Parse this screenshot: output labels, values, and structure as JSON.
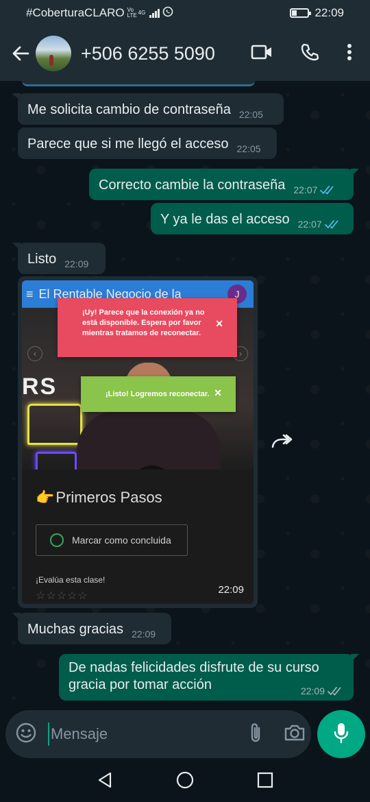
{
  "status_bar": {
    "carrier": "#CoberturaCLARO",
    "volte": "Vo LTE",
    "network": "4G",
    "time": "22:09"
  },
  "header": {
    "contact": "+506 6255 5090",
    "icons": [
      "back-arrow-icon",
      "video-call-icon",
      "phone-icon",
      "more-vert-icon"
    ]
  },
  "messages": [
    {
      "dir": "in",
      "text": "Me solicita cambio de contraseña",
      "time": "22:05"
    },
    {
      "dir": "in",
      "text": "Parece que si me llegó el acceso",
      "time": "22:05"
    },
    {
      "dir": "out",
      "text": "Correcto cambie la contraseña",
      "time": "22:07",
      "status": "read"
    },
    {
      "dir": "out",
      "text": "Y ya le das el acceso",
      "time": "22:07",
      "status": "read"
    },
    {
      "dir": "in",
      "text": "Listo",
      "time": "22:09"
    },
    {
      "dir": "in",
      "text": "Muchas gracias",
      "time": "22:09"
    },
    {
      "dir": "out",
      "text": "De nadas felicidades disfrute de su curso gracia por tomar acción",
      "time": "22:09",
      "status": "delivered"
    }
  ],
  "media_message": {
    "time": "22:09",
    "screenshot": {
      "bar_title": "El Rentable Negocio de la",
      "avatar_letter": "J",
      "brand_fragment": "RS",
      "alert_red": "¡Uy! Parece que la conexión ya no está disponible. Espera por favor mientras tratamos de reconectar.",
      "alert_green": "¡Listo! Logremos reconectar.",
      "close_glyph": "✕",
      "lesson_emoji": "👉",
      "lesson_title": "Primeros Pasos",
      "complete_button": "Marcar como concluida",
      "rate_prompt": "¡Evalúa esta clase!",
      "stars": "☆☆☆☆☆"
    }
  },
  "composer": {
    "placeholder": "Mensaje",
    "icons": [
      "emoji-icon",
      "attach-icon",
      "camera-icon",
      "mic-icon"
    ]
  },
  "navbar": {
    "icons": [
      "nav-back-icon",
      "nav-home-icon",
      "nav-recents-icon"
    ]
  },
  "colors": {
    "background": "#0b141a",
    "bar": "#1f2c34",
    "incoming": "#1f2c34",
    "outgoing": "#005c4b",
    "accent": "#00a884",
    "read_tick": "#53bdeb"
  }
}
